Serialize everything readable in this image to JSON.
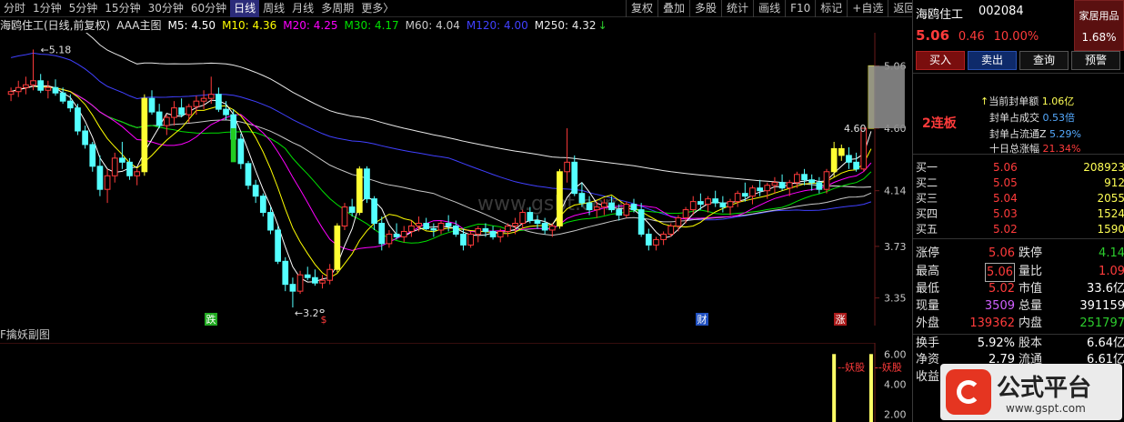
{
  "toolbar": {
    "period_tabs": [
      "分时",
      "1分钟",
      "5分钟",
      "15分钟",
      "30分钟",
      "60分钟",
      "日线",
      "周线",
      "月线",
      "多周期",
      "更多〉"
    ],
    "active_tab": "日线",
    "buttons": [
      "复权",
      "叠加",
      "多股",
      "统计",
      "画线",
      "F10",
      "标记",
      "+自选",
      "返回"
    ]
  },
  "legend": {
    "stock": "海鸥住工(日线,前复权)",
    "indicator": "AAA主图",
    "ma5": "M5: 4.50",
    "ma10": "M10: 4.36",
    "ma20": "M20: 4.25",
    "ma30": "M30: 4.17",
    "ma60": "M60: 4.04",
    "ma120": "M120: 4.00",
    "ma250": "M250: 4.32",
    "ma250_arrow": "↓",
    "colors": {
      "ma5": "#ffffff",
      "ma10": "#ffff00",
      "ma20": "#ff00ff",
      "ma30": "#00e000",
      "ma60": "#c8c8c8",
      "ma120": "#4040ff",
      "ma250": "#e8e8e8"
    }
  },
  "chart": {
    "price_ticks": [
      "5.06",
      "4.60",
      "4.14",
      "3.73",
      "3.35"
    ],
    "high_label": "5.18",
    "low_label": "3.28",
    "last_label": "4.60",
    "watermark": "www.gsbt.com",
    "event_marks": [
      "跌",
      "$",
      "财",
      "涨"
    ]
  },
  "sub_chart": {
    "title": "F擒妖副图",
    "ticks": [
      "6.00",
      "4.00",
      "2.00"
    ],
    "signal_text": "妖股"
  },
  "chart_data": {
    "type": "candlestick",
    "title": "海鸥住工(日线,前复权)",
    "ylim": [
      3.2,
      5.25
    ],
    "y_ticks": [
      5.06,
      4.6,
      4.14,
      3.73,
      3.35
    ],
    "candles": [
      [
        4.85,
        4.9,
        4.8,
        4.87
      ],
      [
        4.87,
        4.95,
        4.83,
        4.9
      ],
      [
        4.9,
        4.98,
        4.85,
        4.92
      ],
      [
        4.92,
        5.18,
        4.88,
        4.95
      ],
      [
        4.95,
        5.0,
        4.86,
        4.88
      ],
      [
        4.88,
        4.95,
        4.82,
        4.9
      ],
      [
        4.9,
        4.96,
        4.84,
        4.86
      ],
      [
        4.86,
        4.9,
        4.78,
        4.8
      ],
      [
        4.8,
        4.85,
        4.72,
        4.75
      ],
      [
        4.75,
        4.78,
        4.55,
        4.58
      ],
      [
        4.58,
        4.62,
        4.45,
        4.48
      ],
      [
        4.48,
        4.5,
        4.28,
        4.32
      ],
      [
        4.32,
        4.4,
        4.1,
        4.15
      ],
      [
        4.15,
        4.3,
        4.05,
        4.25
      ],
      [
        4.25,
        4.42,
        4.2,
        4.38
      ],
      [
        4.38,
        4.5,
        4.3,
        4.35
      ],
      [
        4.35,
        4.38,
        4.22,
        4.25
      ],
      [
        4.25,
        4.3,
        4.18,
        4.28
      ],
      [
        4.28,
        4.85,
        4.25,
        4.82
      ],
      [
        4.82,
        4.88,
        4.7,
        4.72
      ],
      [
        4.72,
        4.78,
        4.6,
        4.62
      ],
      [
        4.62,
        4.7,
        4.55,
        4.68
      ],
      [
        4.68,
        4.8,
        4.62,
        4.75
      ],
      [
        4.75,
        4.82,
        4.68,
        4.7
      ],
      [
        4.7,
        4.78,
        4.64,
        4.76
      ],
      [
        4.76,
        4.84,
        4.7,
        4.8
      ],
      [
        4.8,
        4.88,
        4.74,
        4.82
      ],
      [
        4.82,
        4.98,
        4.78,
        4.85
      ],
      [
        4.85,
        4.9,
        4.72,
        4.74
      ],
      [
        4.74,
        4.8,
        4.66,
        4.7
      ],
      [
        4.7,
        4.74,
        4.5,
        4.52
      ],
      [
        4.52,
        4.56,
        4.3,
        4.34
      ],
      [
        4.34,
        4.36,
        4.15,
        4.18
      ],
      [
        4.18,
        4.22,
        4.05,
        4.1
      ],
      [
        4.1,
        4.12,
        3.95,
        3.98
      ],
      [
        3.98,
        4.02,
        3.82,
        3.85
      ],
      [
        3.85,
        3.88,
        3.6,
        3.62
      ],
      [
        3.62,
        3.65,
        3.4,
        3.45
      ],
      [
        3.45,
        3.5,
        3.28,
        3.4
      ],
      [
        3.4,
        3.55,
        3.38,
        3.52
      ],
      [
        3.52,
        3.58,
        3.48,
        3.5
      ],
      [
        3.5,
        3.56,
        3.44,
        3.46
      ],
      [
        3.46,
        3.52,
        3.42,
        3.48
      ],
      [
        3.48,
        3.6,
        3.45,
        3.56
      ],
      [
        3.56,
        3.9,
        3.54,
        3.88
      ],
      [
        3.88,
        4.05,
        3.85,
        4.02
      ],
      [
        4.02,
        4.08,
        3.95,
        3.98
      ],
      [
        3.98,
        4.32,
        3.96,
        4.3
      ],
      [
        4.3,
        4.32,
        4.05,
        4.08
      ],
      [
        4.08,
        4.1,
        3.85,
        3.9
      ],
      [
        3.9,
        3.95,
        3.7,
        3.75
      ],
      [
        3.75,
        3.85,
        3.72,
        3.82
      ],
      [
        3.82,
        3.9,
        3.78,
        3.8
      ],
      [
        3.8,
        3.88,
        3.76,
        3.84
      ],
      [
        3.84,
        3.92,
        3.8,
        3.88
      ],
      [
        3.88,
        3.95,
        3.84,
        3.9
      ],
      [
        3.9,
        3.94,
        3.85,
        3.86
      ],
      [
        3.86,
        3.9,
        3.8,
        3.85
      ],
      [
        3.85,
        3.92,
        3.82,
        3.9
      ],
      [
        3.9,
        3.96,
        3.84,
        3.88
      ],
      [
        3.88,
        3.92,
        3.8,
        3.82
      ],
      [
        3.82,
        3.86,
        3.7,
        3.74
      ],
      [
        3.74,
        3.84,
        3.72,
        3.82
      ],
      [
        3.82,
        3.88,
        3.76,
        3.86
      ],
      [
        3.86,
        3.9,
        3.8,
        3.84
      ],
      [
        3.84,
        3.88,
        3.78,
        3.8
      ],
      [
        3.8,
        3.86,
        3.76,
        3.84
      ],
      [
        3.84,
        3.9,
        3.8,
        3.88
      ],
      [
        3.88,
        3.94,
        3.82,
        3.9
      ],
      [
        3.9,
        4.0,
        3.86,
        3.98
      ],
      [
        3.98,
        4.02,
        3.9,
        3.92
      ],
      [
        3.92,
        3.96,
        3.86,
        3.9
      ],
      [
        3.9,
        3.94,
        3.82,
        3.85
      ],
      [
        3.85,
        3.9,
        3.8,
        3.88
      ],
      [
        3.88,
        4.3,
        3.86,
        4.28
      ],
      [
        4.28,
        4.6,
        4.2,
        4.35
      ],
      [
        4.35,
        4.4,
        4.1,
        4.12
      ],
      [
        4.12,
        4.2,
        4.02,
        4.05
      ],
      [
        4.05,
        4.1,
        3.96,
        4.0
      ],
      [
        4.0,
        4.06,
        3.94,
        4.02
      ],
      [
        4.02,
        4.08,
        3.96,
        4.05
      ],
      [
        4.05,
        4.1,
        3.98,
        4.0
      ],
      [
        4.0,
        4.04,
        3.92,
        3.96
      ],
      [
        3.96,
        4.06,
        3.94,
        4.04
      ],
      [
        4.04,
        4.08,
        3.98,
        4.0
      ],
      [
        4.0,
        4.05,
        3.8,
        3.82
      ],
      [
        3.82,
        3.86,
        3.7,
        3.74
      ],
      [
        3.74,
        3.8,
        3.7,
        3.78
      ],
      [
        3.78,
        3.84,
        3.74,
        3.82
      ],
      [
        3.82,
        3.9,
        3.8,
        3.88
      ],
      [
        3.88,
        3.96,
        3.84,
        3.94
      ],
      [
        3.94,
        4.02,
        3.9,
        4.0
      ],
      [
        4.0,
        4.1,
        3.96,
        4.06
      ],
      [
        4.06,
        4.12,
        4.0,
        4.04
      ],
      [
        4.04,
        4.1,
        3.98,
        4.08
      ],
      [
        4.08,
        4.14,
        4.02,
        4.05
      ],
      [
        4.05,
        4.1,
        3.98,
        4.02
      ],
      [
        4.02,
        4.08,
        3.96,
        4.06
      ],
      [
        4.06,
        4.14,
        4.02,
        4.12
      ],
      [
        4.12,
        4.2,
        4.06,
        4.1
      ],
      [
        4.1,
        4.18,
        4.04,
        4.16
      ],
      [
        4.16,
        4.22,
        4.1,
        4.14
      ],
      [
        4.14,
        4.2,
        4.08,
        4.18
      ],
      [
        4.18,
        4.24,
        4.12,
        4.2
      ],
      [
        4.2,
        4.26,
        4.14,
        4.16
      ],
      [
        4.16,
        4.22,
        4.1,
        4.2
      ],
      [
        4.2,
        4.28,
        4.16,
        4.26
      ],
      [
        4.26,
        4.3,
        4.18,
        4.22
      ],
      [
        4.22,
        4.26,
        4.14,
        4.2
      ],
      [
        4.2,
        4.24,
        4.12,
        4.15
      ],
      [
        4.15,
        4.3,
        4.12,
        4.28
      ],
      [
        4.28,
        4.5,
        4.24,
        4.45
      ],
      [
        4.45,
        4.48,
        4.36,
        4.4
      ],
      [
        4.4,
        4.46,
        4.3,
        4.35
      ],
      [
        4.35,
        4.42,
        4.28,
        4.3
      ],
      [
        4.3,
        4.6,
        4.28,
        4.6
      ],
      [
        4.6,
        5.06,
        4.6,
        5.06
      ]
    ],
    "limit_up_days": [
      18,
      44,
      47,
      74,
      111,
      112,
      116
    ],
    "ma": {
      "M5": 4.5,
      "M10": 4.36,
      "M20": 4.25,
      "M30": 4.17,
      "M60": 4.04,
      "M120": 4.0,
      "M250": 4.32
    },
    "sub_ylim": [
      1.5,
      6.5
    ],
    "sub_bars": [
      {
        "index": 111,
        "value": 6.0
      },
      {
        "index": 116,
        "value": 6.0
      }
    ]
  },
  "quote": {
    "name": "海鸥住工",
    "code": "002084",
    "sector_name": "家居用品",
    "sector_pct": "1.68%",
    "price": "5.06",
    "change": "0.46",
    "change_pct": "10.00%",
    "buttons": [
      "买入",
      "卖出",
      "查询",
      "预警"
    ],
    "streak": "2连板",
    "seal": [
      {
        "label": "当前封单额",
        "value": "1.06亿"
      },
      {
        "label": "封单占成交",
        "value": "0.53倍"
      },
      {
        "label": "封单占流通Z",
        "value": "5.29%"
      },
      {
        "label": "十日总涨幅",
        "value": "21.34%"
      }
    ],
    "order_book": [
      {
        "label": "买一",
        "price": "5.06",
        "vol": "208923"
      },
      {
        "label": "买二",
        "price": "5.05",
        "vol": "912"
      },
      {
        "label": "买三",
        "price": "5.04",
        "vol": "2055"
      },
      {
        "label": "买四",
        "price": "5.03",
        "vol": "1524"
      },
      {
        "label": "买五",
        "price": "5.02",
        "vol": "1590"
      }
    ],
    "stats": [
      {
        "l1": "涨停",
        "v1": "5.06",
        "l2": "跌停",
        "v2": "4.14"
      },
      {
        "l1": "最高",
        "v1": "5.06",
        "l2": "量比",
        "v2": "1.09"
      },
      {
        "l1": "最低",
        "v1": "5.02",
        "l2": "市值",
        "v2": "33.6亿"
      },
      {
        "l1": "现量",
        "v1": "3509",
        "l2": "总量",
        "v2": "391159"
      },
      {
        "l1": "外盘",
        "v1": "139362",
        "l2": "内盘",
        "v2": "251797"
      },
      {
        "l1": "换手",
        "v1": "5.92%",
        "l2": "股本",
        "v2": "6.64亿"
      },
      {
        "l1": "净资",
        "v1": "2.79",
        "l2": "流通",
        "v2": "6.61亿"
      },
      {
        "l1": "收益",
        "v1": "",
        "l2": "",
        "v2": ""
      }
    ]
  },
  "watermark_badge": {
    "title": "公式平台",
    "url": "www.gspt.com"
  }
}
